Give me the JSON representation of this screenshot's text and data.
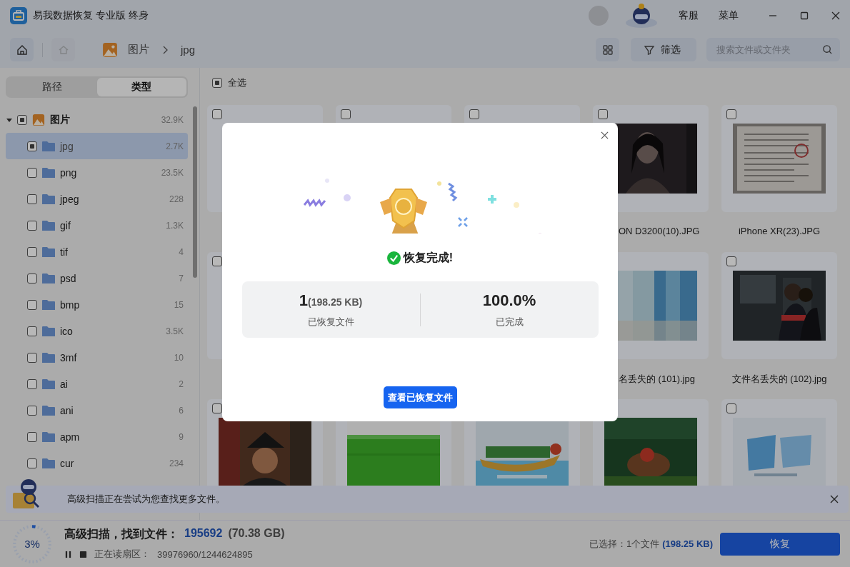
{
  "window": {
    "title": "易我数据恢复 专业版 终身",
    "menu_items": [
      "客服",
      "菜单"
    ]
  },
  "toolbar": {
    "back_disabled": true,
    "breadcrumb": [
      "图片",
      "jpg"
    ],
    "filter_label": "筛选",
    "search": {
      "placeholder": "搜索文件或文件夹"
    }
  },
  "sidebar": {
    "tabs": [
      {
        "label": "路径",
        "selected": false
      },
      {
        "label": "类型",
        "selected": true
      }
    ],
    "tree": [
      {
        "label": "图片",
        "count": "32.9K",
        "partial": true,
        "selected": false,
        "expanded": true,
        "children": [
          {
            "label": "jpg",
            "count": "2.7K",
            "partial": true,
            "selected": true
          },
          {
            "label": "png",
            "count": "23.5K",
            "partial": false,
            "selected": false
          },
          {
            "label": "jpeg",
            "count": "228",
            "partial": false,
            "selected": false
          },
          {
            "label": "gif",
            "count": "1.3K",
            "partial": false,
            "selected": false
          },
          {
            "label": "tif",
            "count": "4",
            "partial": false,
            "selected": false
          },
          {
            "label": "psd",
            "count": "7",
            "partial": false,
            "selected": false
          },
          {
            "label": "bmp",
            "count": "15",
            "partial": false,
            "selected": false
          },
          {
            "label": "ico",
            "count": "3.5K",
            "partial": false,
            "selected": false
          },
          {
            "label": "3mf",
            "count": "10",
            "partial": false,
            "selected": false
          },
          {
            "label": "ai",
            "count": "2",
            "partial": false,
            "selected": false
          },
          {
            "label": "ani",
            "count": "6",
            "partial": false,
            "selected": false
          },
          {
            "label": "apm",
            "count": "9",
            "partial": false,
            "selected": false
          },
          {
            "label": "cur",
            "count": "234",
            "partial": false,
            "selected": false
          }
        ]
      }
    ]
  },
  "content": {
    "select_all": {
      "label": "全选",
      "partial": true
    },
    "cards": [
      {
        "kind": "blank",
        "checked": false
      },
      {
        "kind": "blank",
        "checked": false
      },
      {
        "kind": "blank",
        "checked": false
      },
      {
        "kind": "picture",
        "checked": false,
        "label": "ON D3200(10).JPG"
      },
      {
        "kind": "picture",
        "checked": false,
        "label": "iPhone XR(23).JPG"
      },
      {
        "kind": "blank",
        "checked": false
      },
      {
        "kind": "covered"
      },
      {
        "kind": "covered"
      },
      {
        "kind": "picture",
        "label": "名丢失的 (101).jpg"
      },
      {
        "kind": "picture",
        "checked": false,
        "label": "文件名丢失的 (102).jpg"
      },
      {
        "kind": "picture",
        "checked": false
      },
      {
        "kind": "picture"
      },
      {
        "kind": "picture"
      },
      {
        "kind": "picture"
      },
      {
        "kind": "picture",
        "checked": false
      }
    ]
  },
  "notification": {
    "text": "高级扫描正在尝试为您查找更多文件。"
  },
  "status_bar": {
    "progress": {
      "level": 0.03,
      "label": "3%"
    },
    "scan_label": "高级扫描，找到文件：",
    "found_count": "195692",
    "found_size": "(70.38 GB)",
    "sector_label": "正在读扇区：",
    "sector_value": "39976960/1244624895",
    "selection_label": "已选择：1个文件",
    "selection_size": "(198.25 KB)",
    "recover_button": "恢复"
  },
  "dialog": {
    "title": "恢复完成!",
    "stats": [
      {
        "value": "1",
        "detail": "(198.25 KB)",
        "label": "已恢复文件"
      },
      {
        "value": "100.0%",
        "label": "已完成"
      }
    ],
    "button": "查看已恢复文件"
  }
}
